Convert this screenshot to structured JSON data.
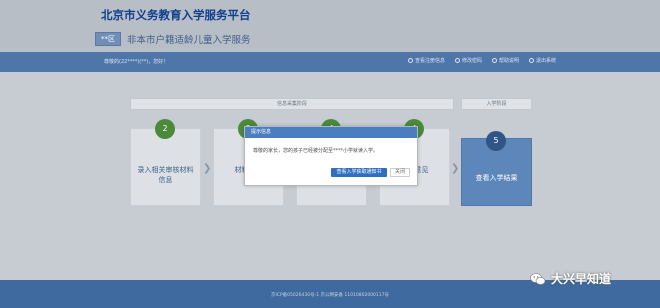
{
  "header": {
    "site_title": "北京市义务教育入学服务平台",
    "district": "**区",
    "sub_title": "非本市户籍适龄儿童入学服务"
  },
  "navbar": {
    "welcome": "尊敬的(22****)(**)，您好！",
    "links": [
      {
        "label": "查看注册信息",
        "icon": "user-icon"
      },
      {
        "label": "修改密码",
        "icon": "lock-icon"
      },
      {
        "label": "帮助说明",
        "icon": "help-icon"
      },
      {
        "label": "退出系统",
        "icon": "logout-icon"
      }
    ]
  },
  "sections": {
    "left": "信息采集阶段",
    "right": "入学阶段"
  },
  "steps": [
    {
      "number": "2",
      "label": "录入相关审核材料信息"
    },
    {
      "number": "3",
      "label": "材料证明"
    },
    {
      "number": "4",
      "label": ""
    },
    {
      "number": "4",
      "label": "审核意见"
    },
    {
      "number": "5",
      "label": "查看入学结果"
    }
  ],
  "dialog": {
    "title": "提示信息",
    "message": "尊敬的家长，您的孩子已经被分配至****小学就读入学。",
    "primary_button": "查看入学获取通知书",
    "close_button": "关闭"
  },
  "footer": {
    "text": "京ICP备05026430号-1  京公网安备 11010802000117号"
  },
  "watermark": {
    "text": "大兴早知道"
  },
  "colors": {
    "header_bg": "#b8bec6",
    "navbar_bg": "#4f76a9",
    "footer_bg": "#3f6aa0",
    "step_badge": "#4c8a3a",
    "final_step": "#5d87ba",
    "dialog_header": "#4a7ec0",
    "primary_button": "#2f6fc0"
  }
}
